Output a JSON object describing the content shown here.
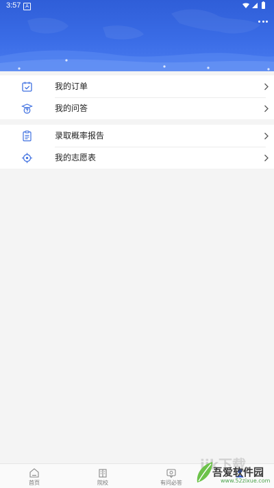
{
  "status_bar": {
    "time": "3:57",
    "badge": "A"
  },
  "menu_groups": [
    {
      "items": [
        {
          "label": "我的订单",
          "icon": "calendar-check-icon"
        },
        {
          "label": "我的问答",
          "icon": "graduate-question-icon"
        }
      ]
    },
    {
      "items": [
        {
          "label": "录取概率报告",
          "icon": "clipboard-report-icon"
        },
        {
          "label": "我的志愿表",
          "icon": "target-icon"
        }
      ]
    }
  ],
  "tabbar": {
    "items": [
      {
        "label": "首页",
        "icon": "home-icon"
      },
      {
        "label": "院校",
        "icon": "school-building-icon"
      },
      {
        "label": "有问必答",
        "icon": "qa-icon"
      },
      {
        "label": "",
        "icon": "profile-icon"
      }
    ]
  },
  "watermark": {
    "brand": "吾爱软件园",
    "url": "www.52zixue.com",
    "ghost": "ijk下载"
  },
  "colors": {
    "primary": "#2f5ed8",
    "icon_blue": "#3d6fe0",
    "background": "#f4f4f4"
  }
}
